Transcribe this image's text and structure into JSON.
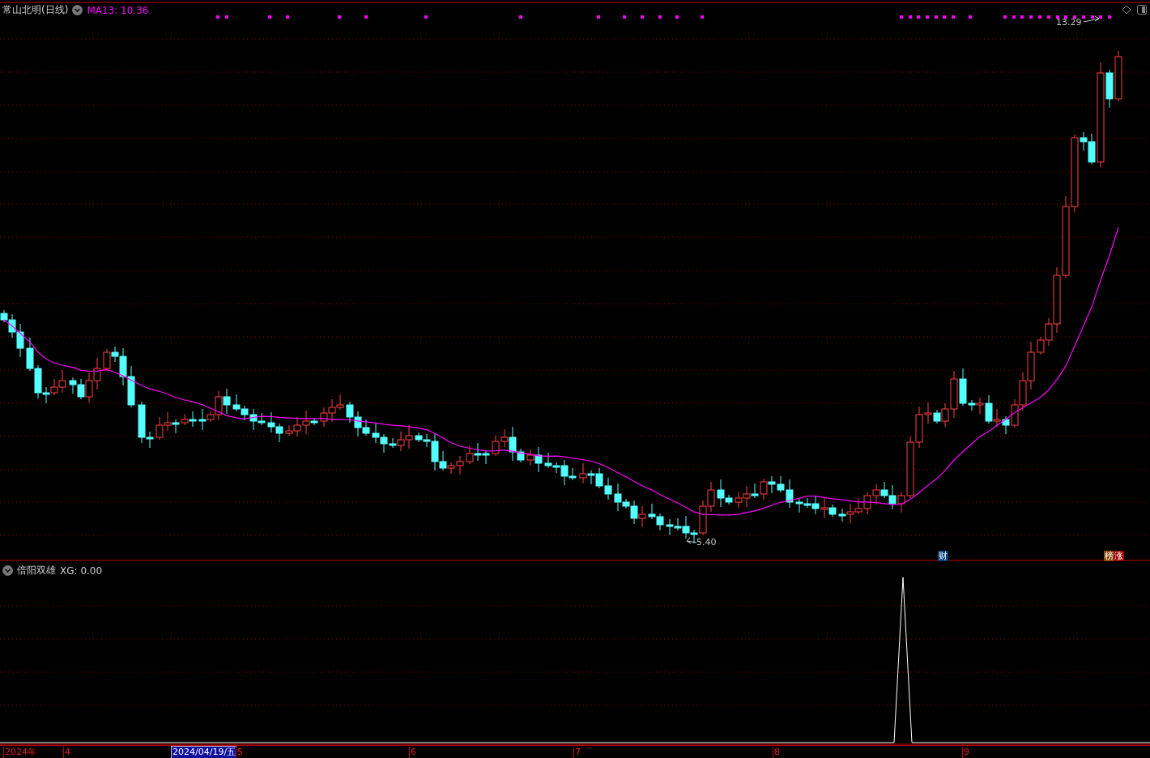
{
  "chart": {
    "title": "常山北明(日线)",
    "indicator": "MA13: 10.36",
    "high_label": "13.29",
    "low_label": "5.40",
    "badges": [
      {
        "text": "财",
        "color": "#0a3c78"
      },
      {
        "text": "榜",
        "color": "#8a4a10"
      },
      {
        "text": "涨",
        "color": "#a00000"
      }
    ]
  },
  "sub_chart": {
    "title": "倍阳双雄",
    "reading": "XG: 0.00"
  },
  "time_axis": [
    {
      "label": "2024年",
      "selected": false
    },
    {
      "label": "4",
      "selected": false
    },
    {
      "label": "2024/04/19/五",
      "selected": true
    },
    {
      "label": "5",
      "selected": false
    },
    {
      "label": "6",
      "selected": false
    },
    {
      "label": "7",
      "selected": false
    },
    {
      "label": "8",
      "selected": false
    },
    {
      "label": "9",
      "selected": false
    }
  ]
}
